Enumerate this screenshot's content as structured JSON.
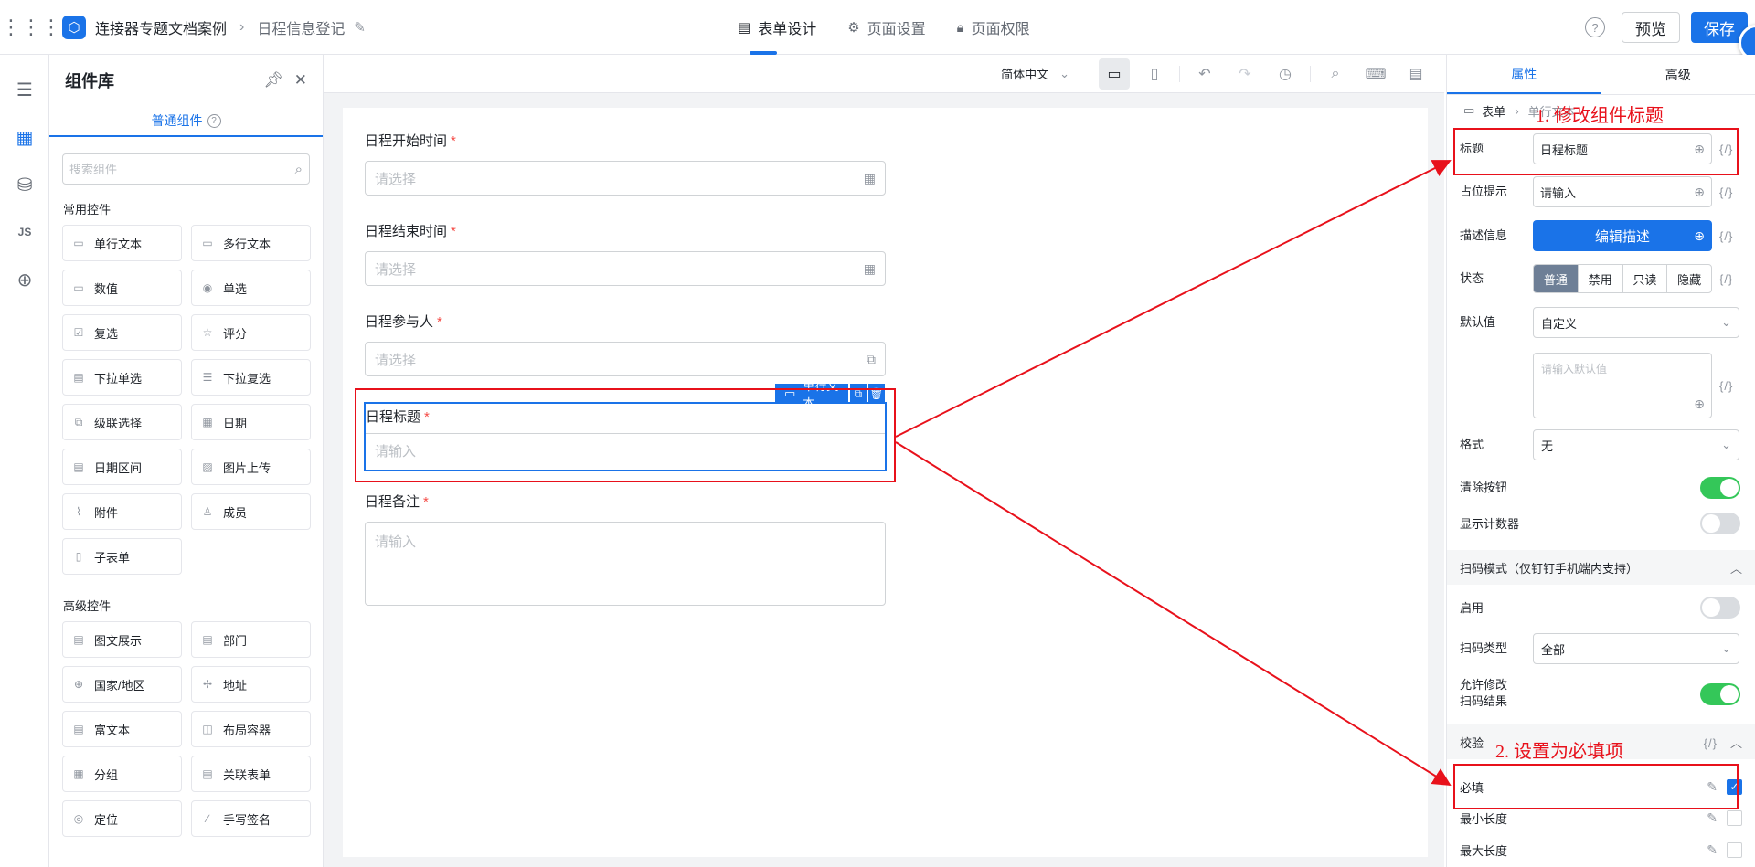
{
  "header": {
    "app_name": "连接器专题文档案例",
    "page_name": "日程信息登记",
    "tabs": [
      {
        "label": "表单设计",
        "icon": "doc-icon"
      },
      {
        "label": "页面设置",
        "icon": "gear-icon"
      },
      {
        "label": "页面权限",
        "icon": "lock-icon"
      }
    ],
    "preview_label": "预览",
    "save_label": "保存"
  },
  "library": {
    "title": "组件库",
    "tab_label": "普通组件",
    "search_placeholder": "搜索组件",
    "common_title": "常用控件",
    "common": [
      {
        "label": "单行文本",
        "icon": "single-line-icon"
      },
      {
        "label": "多行文本",
        "icon": "multi-line-icon"
      },
      {
        "label": "数值",
        "icon": "number-icon"
      },
      {
        "label": "单选",
        "icon": "radio-icon"
      },
      {
        "label": "复选",
        "icon": "checkbox-icon"
      },
      {
        "label": "评分",
        "icon": "star-icon"
      },
      {
        "label": "下拉单选",
        "icon": "dropdown-icon"
      },
      {
        "label": "下拉复选",
        "icon": "dropdown-multi-icon"
      },
      {
        "label": "级联选择",
        "icon": "cascade-icon"
      },
      {
        "label": "日期",
        "icon": "calendar-icon"
      },
      {
        "label": "日期区间",
        "icon": "date-range-icon"
      },
      {
        "label": "图片上传",
        "icon": "image-icon"
      },
      {
        "label": "附件",
        "icon": "attachment-icon"
      },
      {
        "label": "成员",
        "icon": "user-icon"
      },
      {
        "label": "子表单",
        "icon": "subform-icon"
      }
    ],
    "advanced_title": "高级控件",
    "advanced": [
      {
        "label": "图文展示",
        "icon": "image-text-icon"
      },
      {
        "label": "部门",
        "icon": "department-icon"
      },
      {
        "label": "国家/地区",
        "icon": "globe-icon"
      },
      {
        "label": "地址",
        "icon": "address-icon"
      },
      {
        "label": "富文本",
        "icon": "rich-text-icon"
      },
      {
        "label": "布局容器",
        "icon": "layout-icon"
      },
      {
        "label": "分组",
        "icon": "group-icon"
      },
      {
        "label": "关联表单",
        "icon": "link-form-icon"
      },
      {
        "label": "定位",
        "icon": "location-icon"
      },
      {
        "label": "手写签名",
        "icon": "signature-icon"
      }
    ]
  },
  "toolbar": {
    "language": "简体中文"
  },
  "form": {
    "fields": [
      {
        "label": "日程开始时间",
        "required": "*",
        "placeholder": "请选择"
      },
      {
        "label": "日程结束时间",
        "required": "*",
        "placeholder": "请选择"
      },
      {
        "label": "日程参与人",
        "required": "*",
        "placeholder": "请选择"
      },
      {
        "label": "日程标题",
        "required": "*",
        "placeholder": "请输入"
      },
      {
        "label": "日程备注",
        "required": "*",
        "placeholder": "请输入"
      }
    ],
    "selected_tag": "单行文本"
  },
  "props": {
    "tab_props": "属性",
    "tab_advanced": "高级",
    "crumb_root": "表单",
    "crumb_current": "单行文本",
    "title_label": "标题",
    "title_value": "日程标题",
    "placeholder_label": "占位提示",
    "placeholder_value": "请输入",
    "desc_label": "描述信息",
    "desc_button": "编辑描述",
    "state_label": "状态",
    "state_options": [
      "普通",
      "禁用",
      "只读",
      "隐藏"
    ],
    "default_label": "默认值",
    "default_value": "自定义",
    "default_placeholder": "请输入默认值",
    "format_label": "格式",
    "format_value": "无",
    "clear_label": "清除按钮",
    "counter_label": "显示计数器",
    "scan_group": "扫码模式（仅钉钉手机端内支持）",
    "scan_enable_label": "启用",
    "scan_type_label": "扫码类型",
    "scan_type_value": "全部",
    "scan_modify_label_1": "允许修改",
    "scan_modify_label_2": "扫码结果",
    "validate_group": "校验",
    "validate_expr": "{/}",
    "required_label": "必填",
    "min_label": "最小长度",
    "max_label": "最大长度",
    "expr": "{/}"
  },
  "annotations": {
    "step1": "1. 修改组件标题",
    "step2": "2. 设置为必填项"
  },
  "colors": {
    "accent": "#1a73e8",
    "annotation": "#e8111b",
    "toggle_on": "#34c759"
  }
}
